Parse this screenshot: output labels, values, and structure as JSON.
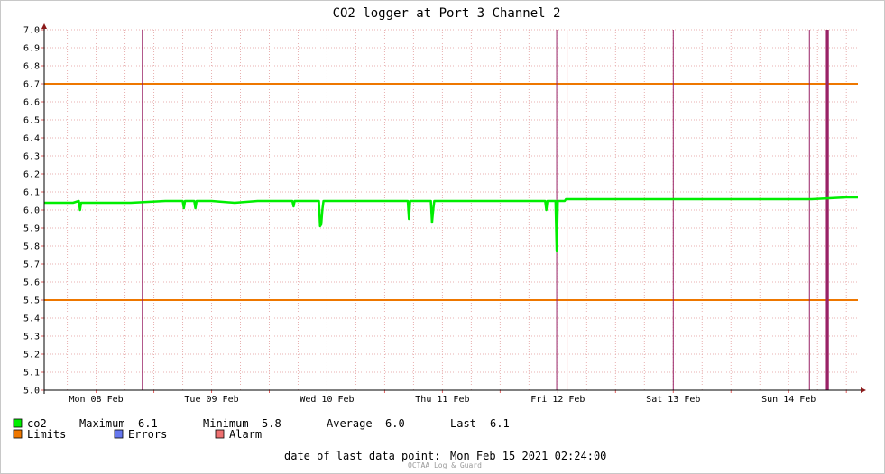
{
  "chart_data": {
    "type": "line",
    "title": "CO2 logger at Port 3 Channel 2",
    "xlabel": "",
    "ylabel": "",
    "ylim": [
      5.0,
      7.0
    ],
    "ystep": 0.1,
    "y_ticks": [
      "7.0",
      "6.9",
      "6.8",
      "6.7",
      "6.6",
      "6.5",
      "6.4",
      "6.3",
      "6.2",
      "6.1",
      "6.0",
      "5.9",
      "5.8",
      "5.7",
      "5.6",
      "5.5",
      "5.4",
      "5.3",
      "5.2",
      "5.1",
      "5.0"
    ],
    "x_unit": "days since Mon 08 Feb 00:00",
    "xlim": [
      -0.45,
      6.6
    ],
    "x_ticks": [
      {
        "x": 0.0,
        "label": "Mon 08 Feb"
      },
      {
        "x": 1.0,
        "label": "Tue 09 Feb"
      },
      {
        "x": 2.0,
        "label": "Wed 10 Feb"
      },
      {
        "x": 3.0,
        "label": "Thu 11 Feb"
      },
      {
        "x": 4.0,
        "label": "Fri 12 Feb"
      },
      {
        "x": 5.0,
        "label": "Sat 13 Feb"
      },
      {
        "x": 6.0,
        "label": "Sun 14 Feb"
      }
    ],
    "grid": true,
    "limits": [
      6.7,
      5.5
    ],
    "alarm_lines": [
      4.08
    ],
    "event_lines": [
      0.4,
      3.99,
      5.0,
      6.18,
      6.33,
      6.34
    ],
    "series": [
      {
        "name": "co2",
        "x": [
          -0.45,
          -0.2,
          -0.15,
          -0.14,
          -0.13,
          0.1,
          0.3,
          0.6,
          0.75,
          0.76,
          0.77,
          0.85,
          0.86,
          0.87,
          1.0,
          1.2,
          1.4,
          1.6,
          1.7,
          1.71,
          1.72,
          1.93,
          1.94,
          1.95,
          1.96,
          1.97,
          2.2,
          2.5,
          2.7,
          2.71,
          2.72,
          2.9,
          2.91,
          2.92,
          2.93,
          3.0,
          3.3,
          3.6,
          3.7,
          3.89,
          3.9,
          3.91,
          3.98,
          3.99,
          4.0,
          4.06,
          4.07,
          4.08,
          4.2,
          4.5,
          4.8,
          4.85,
          4.86,
          4.87,
          5.0,
          5.3,
          5.6,
          5.9,
          6.2,
          6.5,
          6.6
        ],
        "y": [
          6.04,
          6.04,
          6.05,
          6.0,
          6.04,
          6.04,
          6.04,
          6.05,
          6.05,
          6.01,
          6.05,
          6.05,
          6.01,
          6.05,
          6.05,
          6.04,
          6.05,
          6.05,
          6.05,
          6.02,
          6.05,
          6.05,
          5.91,
          5.92,
          6.0,
          6.05,
          6.05,
          6.05,
          6.05,
          5.95,
          6.05,
          6.05,
          5.93,
          6.0,
          6.05,
          6.05,
          6.05,
          6.05,
          6.05,
          6.05,
          6.0,
          6.05,
          6.05,
          5.77,
          6.05,
          6.05,
          6.06,
          6.06,
          6.06,
          6.06,
          6.06,
          6.06,
          6.06,
          6.06,
          6.06,
          6.06,
          6.06,
          6.06,
          6.06,
          6.07,
          6.07
        ]
      }
    ]
  },
  "legend": {
    "co2": "co2",
    "maximum_label": "Maximum",
    "maximum_value": "6.1",
    "minimum_label": "Minimum",
    "minimum_value": "5.8",
    "average_label": "Average",
    "average_value": "6.0",
    "last_label": "Last",
    "last_value": "6.1",
    "limits": "Limits",
    "errors": "Errors",
    "alarm": "Alarm"
  },
  "footer": {
    "last_point_label": "date of last data point:",
    "last_point_value": "Mon Feb 15 2021 02:24:00",
    "brand": "OCTAA Log & Guard"
  },
  "colors": {
    "background": "#ffffff",
    "grid_major": "#e06060",
    "grid_minor": "#e8b0b0",
    "axis": "#000000",
    "series": "#00ee00",
    "limits": "#ee7700",
    "errors": "#6677ee",
    "alarm": "#ee7070",
    "event": "#992266"
  }
}
